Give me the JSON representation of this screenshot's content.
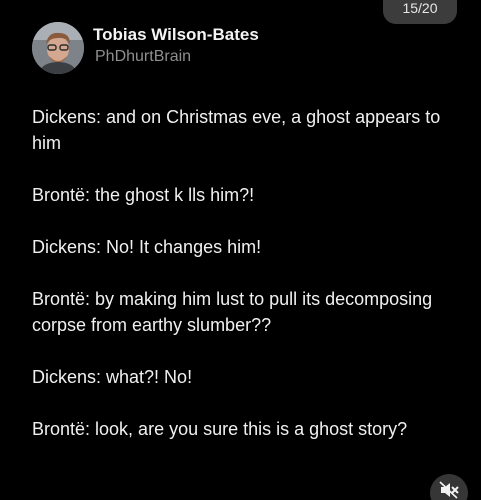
{
  "counter": {
    "text": "15/20"
  },
  "author": {
    "name": "Tobias Wilson-Bates",
    "handle": "PhDhurtBrain"
  },
  "tweet": {
    "paragraphs": [
      "Dickens: and on Christmas eve, a ghost appears to him",
      "Brontë: the ghost k lls him?!",
      "Dickens: No! It changes him!",
      "Brontë: by making him lust to pull its decomposing corpse from earthy slumber??",
      "Dickens: what?! No!",
      "Brontë: look, are you sure this is a ghost story?"
    ]
  },
  "controls": {
    "mute_icon": "speaker-muted-icon"
  },
  "colors": {
    "background": "#000000",
    "text": "#f0f0f0",
    "handle": "#8e8e8e",
    "counter_bg": "#464646"
  }
}
